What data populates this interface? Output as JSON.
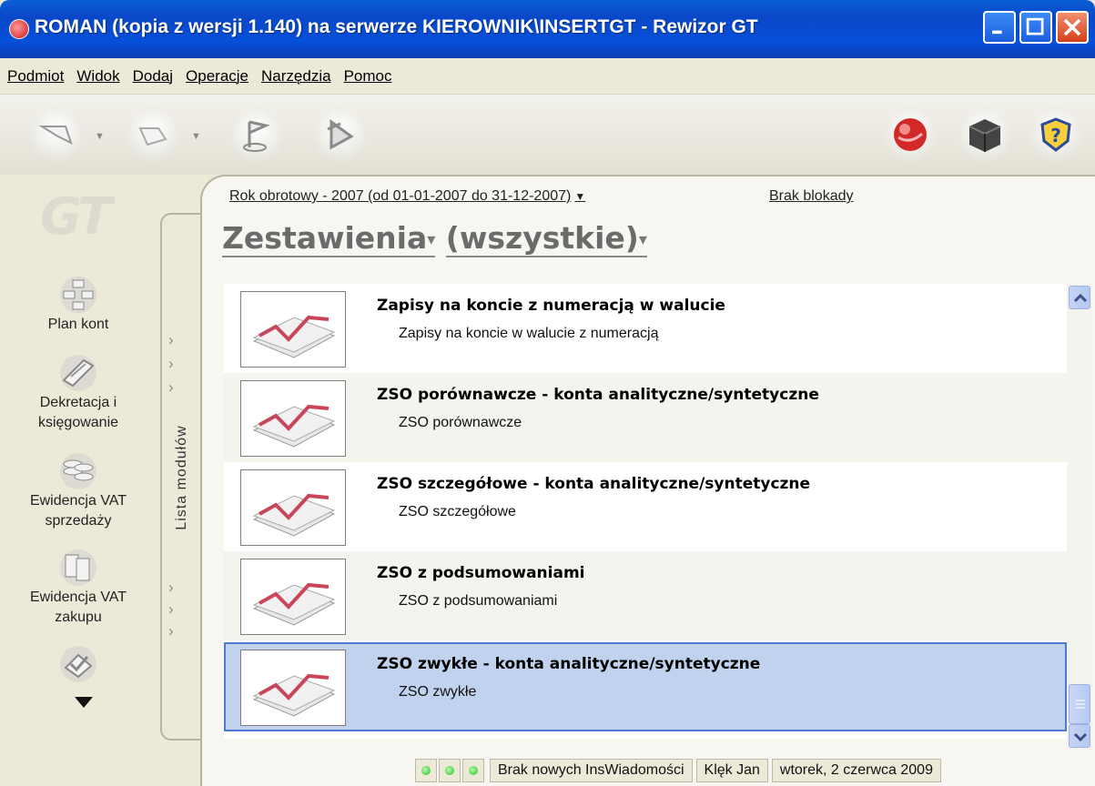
{
  "window": {
    "title": "ROMAN (kopia z wersji 1.140) na serwerze KIEROWNIK\\INSERTGT - Rewizor GT"
  },
  "menu": {
    "items": [
      "Podmiot",
      "Widok",
      "Dodaj",
      "Operacje",
      "Narzędzia",
      "Pomoc"
    ]
  },
  "toolbar": {
    "icons": [
      "back-arrow-icon",
      "forward-arrow-icon",
      "flag-icon",
      "run-icon",
      "globe-icon",
      "cube-icon",
      "help-shield-icon"
    ]
  },
  "sidebar": {
    "logo": "GT",
    "modules": [
      {
        "label1": "Plan kont",
        "label2": ""
      },
      {
        "label1": "Dekretacja i",
        "label2": "księgowanie"
      },
      {
        "label1": "Ewidencja VAT",
        "label2": "sprzedaży"
      },
      {
        "label1": "Ewidencja VAT",
        "label2": "zakupu"
      }
    ],
    "strip_label": "Lista modułów"
  },
  "header": {
    "fiscal_year": "Rok obrotowy - 2007  (od 01-01-2007 do 31-12-2007)",
    "fiscal_year_arrow": "▼",
    "lock_status": "Brak blokady",
    "title": "Zestawienia",
    "filter": "(wszystkie)"
  },
  "reports": [
    {
      "title": "Zapisy na koncie z numeracją w walucie",
      "desc": "Zapisy na koncie w walucie z numeracją"
    },
    {
      "title": "ZSO porównawcze - konta analityczne/syntetyczne",
      "desc": "ZSO porównawcze"
    },
    {
      "title": "ZSO szczegółowe - konta analityczne/syntetyczne",
      "desc": "ZSO szczegółowe"
    },
    {
      "title": "ZSO z podsumowaniami",
      "desc": "ZSO z podsumowaniami"
    },
    {
      "title": "ZSO zwykłe - konta analityczne/syntetyczne",
      "desc": "ZSO zwykłe"
    }
  ],
  "status": {
    "messages": "Brak nowych InsWiadomości",
    "user": "Klęk Jan",
    "date": "wtorek, 2 czerwca 2009"
  },
  "colors": {
    "titlebar": "#0a47c8",
    "selection": "#c1d2ee",
    "selection_border": "#4f7ad2",
    "status_led": "#22b816"
  }
}
